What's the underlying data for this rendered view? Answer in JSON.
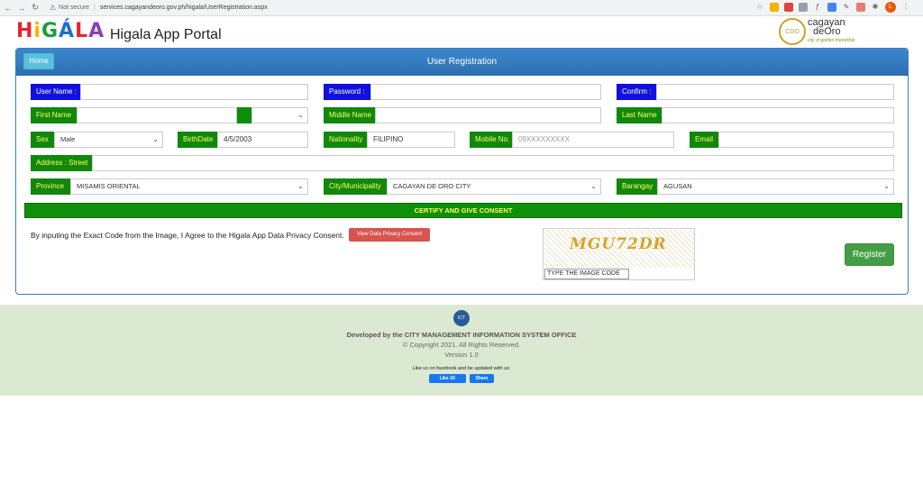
{
  "browser": {
    "security": "Not secure",
    "url": "services.cagayandeoro.gov.ph/higala/UserRegistration.aspx",
    "profile_initial": "L"
  },
  "header": {
    "logo_letters": [
      "H",
      "i",
      "G",
      "Á",
      "L",
      "A"
    ],
    "logo_colors": [
      "#e3262b",
      "#f7b500",
      "#1a9c3c",
      "#1c6fd1",
      "#e3262b",
      "#8e3fb7"
    ],
    "app_title": "Higala App Portal",
    "seal_text": "CDO",
    "brand_line1": "cagayan",
    "brand_line2": "deOro",
    "brand_tagline": "city of golden friendship"
  },
  "panel": {
    "home_label": "Home",
    "title": "User Registration"
  },
  "form": {
    "username_label": "User Name :",
    "password_label": "Password :",
    "confirm_label": "Confirm :",
    "firstname_label": "First Name",
    "middlename_label": "Middle Name",
    "lastname_label": "Last Name",
    "sex_label": "Sex",
    "sex_value": "Male",
    "birthdate_label": "BirthDate",
    "birthdate_value": "4/5/2003",
    "nationality_label": "Nationality",
    "nationality_value": "FILIPINO",
    "mobile_label": "Mobile No.",
    "mobile_placeholder": "09XXXXXXXXX",
    "email_label": "Email",
    "address_label": "Address : Street",
    "province_label": "Province",
    "province_value": "MISAMIS ORIENTAL",
    "city_label": "City/Municipality",
    "city_value": "CAGAYAN DE ORO CITY",
    "barangay_label": "Barangay",
    "barangay_value": "AGUSAN"
  },
  "consent": {
    "bar_label": "CERTIFY AND GIVE CONSENT",
    "text": "By inputing the Exact Code from the Image, I Agree to the Higala App Data Privacy Consent.",
    "privacy_button": "View Data Privacy Consent",
    "captcha_code": "MGU72DR",
    "captcha_placeholder": "TYPE THE IMAGE CODE",
    "register_button": "Register"
  },
  "footer": {
    "ict_text": "ICT",
    "developed_by": "Developed by the CITY MANAGEMENT INFORMATION SYSTEM OFFICE",
    "copyright": "© Copyright 2021. All Rights Reserved.",
    "version": "Version 1.0",
    "facebook_text": "Like us on facebook and be updated with us:",
    "like_label": "Like 1K",
    "share_label": "Share"
  }
}
